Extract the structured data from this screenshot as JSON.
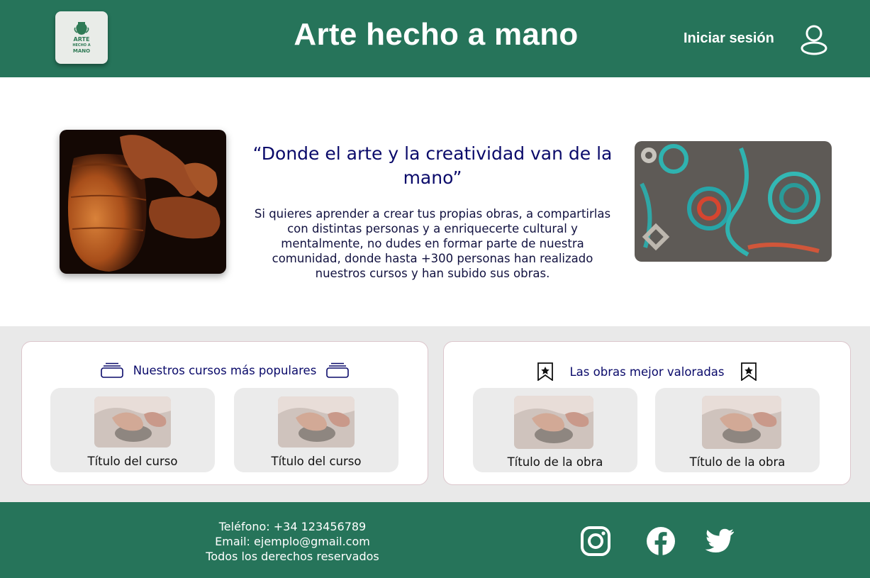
{
  "header": {
    "logo_text": [
      "ARTE",
      "HECHO A",
      "MANO"
    ],
    "title": "Arte hecho a mano",
    "login_label": "Iniciar sesión",
    "icons": {
      "user": "user-icon"
    }
  },
  "hero": {
    "quote": "“Donde el arte y la creatividad van de la mano”",
    "description": "Si quieres aprender a crear tus propias obras, a compartirlas con distintas personas y a enriquecerte cultural y mentalmente, no dudes en formar parte de nuestra comunidad, donde hasta +300 personas han realizado nuestros cursos y han subido sus obras.",
    "images": [
      "pottery-photo",
      "jewelry-photo"
    ]
  },
  "courses": {
    "title": "Nuestros cursos más populares",
    "icon": "stack-icon",
    "items": [
      {
        "title": "Título del curso"
      },
      {
        "title": "Título del curso"
      }
    ]
  },
  "works": {
    "title": "Las obras mejor valoradas",
    "icon": "bookmark-star-icon",
    "items": [
      {
        "title": "Título de la obra"
      },
      {
        "title": "Título de la obra"
      }
    ]
  },
  "footer": {
    "phone": "Teléfono: +34 123456789",
    "email": "Email: ejemplo@gmail.com",
    "rights": "Todos los derechos reservados",
    "social": [
      "instagram-icon",
      "facebook-icon",
      "twitter-icon"
    ]
  },
  "colors": {
    "brand_green": "#26745a",
    "band_gray": "#e9e9e9",
    "text_navy": "#0a0a6a"
  }
}
